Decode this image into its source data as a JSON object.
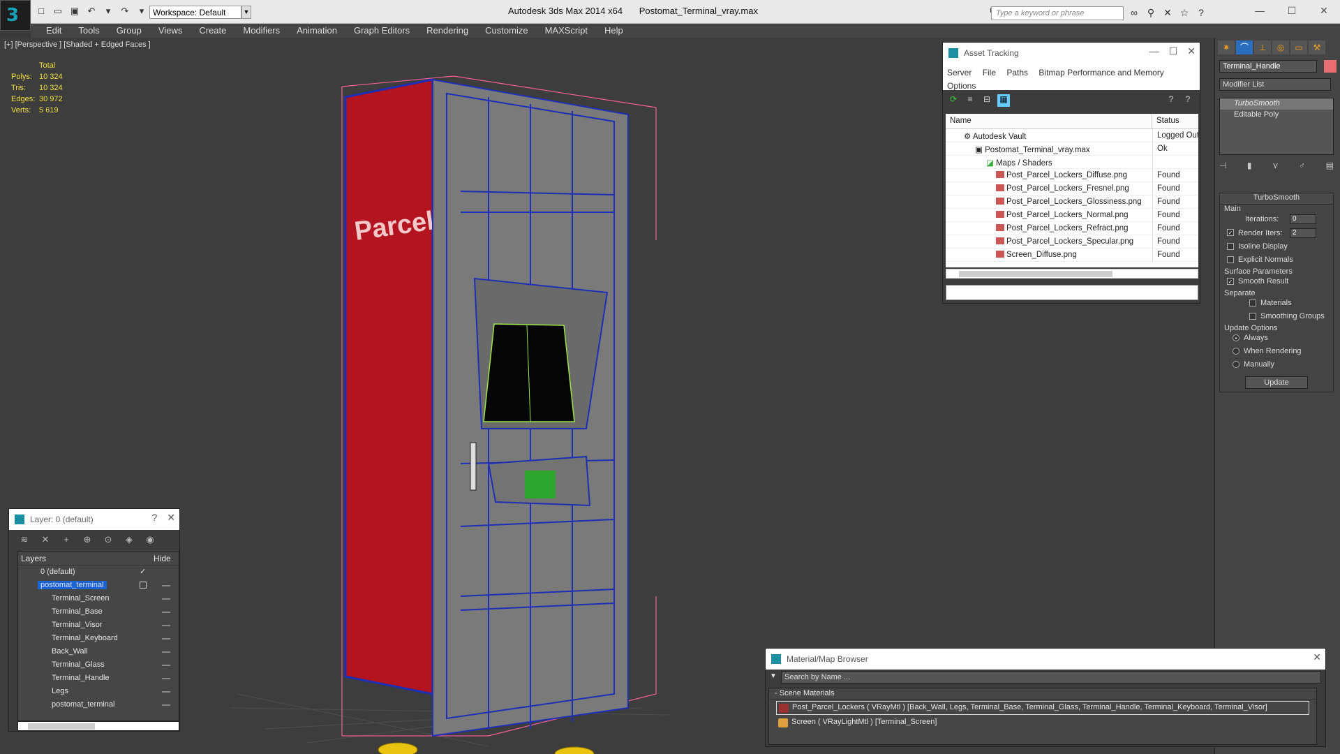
{
  "app": {
    "title": "Autodesk 3ds Max  2014 x64",
    "file": "Postomat_Terminal_vray.max",
    "workspace": "Workspace: Default",
    "search_placeholder": "Type a keyword or phrase"
  },
  "menubar": [
    "Edit",
    "Tools",
    "Group",
    "Views",
    "Create",
    "Modifiers",
    "Animation",
    "Graph Editors",
    "Rendering",
    "Customize",
    "MAXScript",
    "Help"
  ],
  "viewport": {
    "label": "[+] [Perspective ] [Shaded + Edged Faces ]",
    "stats": {
      "header": "Total",
      "rows": [
        {
          "k": "Polys:",
          "v": "10 324"
        },
        {
          "k": "Tris:",
          "v": "10 324"
        },
        {
          "k": "Edges:",
          "v": "30 972"
        },
        {
          "k": "Verts:",
          "v": "5 619"
        }
      ]
    },
    "sign_text": "Parcel Lockers",
    "colors": {
      "wire": "#1f2fb5",
      "sign": "#b3141f",
      "screen_outline": "#9ee64a",
      "legs": "#e8c410",
      "bbox": "#f0609a"
    }
  },
  "asset_tracking": {
    "title": "Asset Tracking",
    "menu": [
      "Server",
      "File",
      "Paths",
      "Bitmap Performance and Memory",
      "Options"
    ],
    "columns": [
      "Name",
      "Status"
    ],
    "rows": [
      {
        "name": "Autodesk Vault",
        "status": "Logged Out"
      },
      {
        "name": "Postomat_Terminal_vray.max",
        "status": "Ok"
      },
      {
        "name": "Maps / Shaders",
        "status": ""
      },
      {
        "name": "Post_Parcel_Lockers_Diffuse.png",
        "status": "Found"
      },
      {
        "name": "Post_Parcel_Lockers_Fresnel.png",
        "status": "Found"
      },
      {
        "name": "Post_Parcel_Lockers_Glossiness.png",
        "status": "Found"
      },
      {
        "name": "Post_Parcel_Lockers_Normal.png",
        "status": "Found"
      },
      {
        "name": "Post_Parcel_Lockers_Refract.png",
        "status": "Found"
      },
      {
        "name": "Post_Parcel_Lockers_Specular.png",
        "status": "Found"
      },
      {
        "name": "Screen_Diffuse.png",
        "status": "Found"
      }
    ]
  },
  "command_panel": {
    "object_name": "Terminal_Handle",
    "modifier_list": "Modifier List",
    "stack": [
      "TurboSmooth",
      "Editable Poly"
    ],
    "rollout_title": "TurboSmooth",
    "main_label": "Main",
    "iterations_label": "Iterations:",
    "iterations_value": "0",
    "render_iters_label": "Render Iters:",
    "render_iters_value": "2",
    "isoline": "Isoline Display",
    "explicit": "Explicit Normals",
    "surface_label": "Surface Parameters",
    "smooth_result": "Smooth Result",
    "separate_label": "Separate",
    "materials": "Materials",
    "smoothing_groups": "Smoothing Groups",
    "update_label": "Update Options",
    "always": "Always",
    "when_rendering": "When Rendering",
    "manually": "Manually",
    "update_button": "Update"
  },
  "layer_explorer": {
    "title": "Layer: 0 (default)",
    "help": "?",
    "col_layers": "Layers",
    "col_hide": "Hide",
    "rows": [
      {
        "name": "0 (default)"
      },
      {
        "name": "postomat_terminal"
      },
      {
        "name": "Terminal_Screen"
      },
      {
        "name": "Terminal_Base"
      },
      {
        "name": "Terminal_Visor"
      },
      {
        "name": "Terminal_Keyboard"
      },
      {
        "name": "Back_Wall"
      },
      {
        "name": "Terminal_Glass"
      },
      {
        "name": "Terminal_Handle"
      },
      {
        "name": "Legs"
      },
      {
        "name": "postomat_terminal"
      }
    ]
  },
  "material_browser": {
    "title": "Material/Map Browser",
    "search_placeholder": "Search by Name ...",
    "category": "Scene Materials",
    "items": [
      {
        "label": "Post_Parcel_Lockers  ( VRayMtl )  [Back_Wall, Legs, Terminal_Base, Terminal_Glass, Terminal_Handle, Terminal_Keyboard, Terminal_Visor]",
        "swatch": "#9a3030"
      },
      {
        "label": "Screen  ( VRayLightMtl )  [Terminal_Screen]",
        "swatch": "#e0a040"
      }
    ]
  }
}
